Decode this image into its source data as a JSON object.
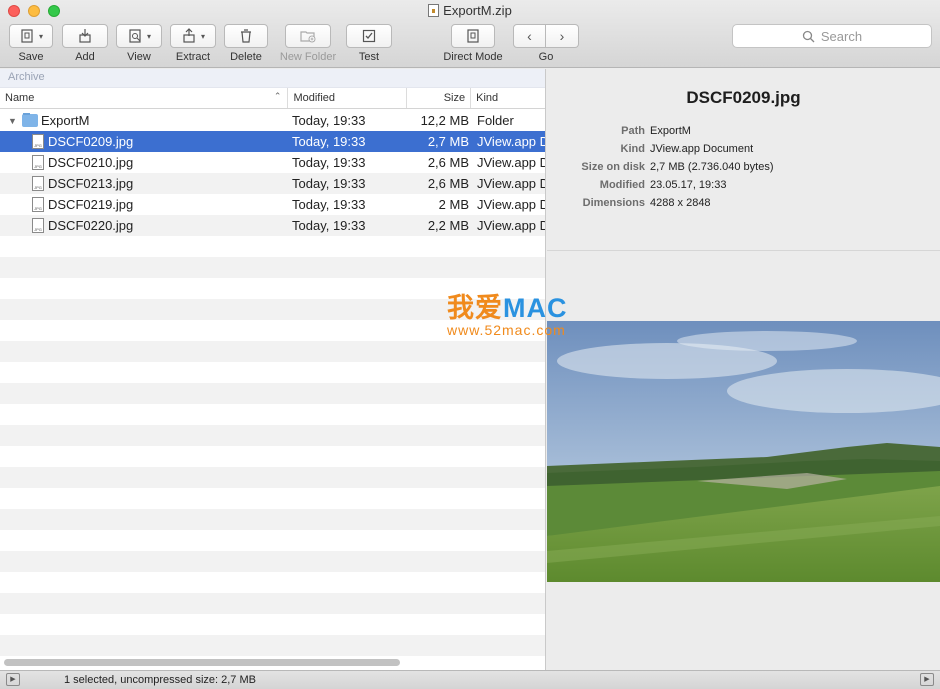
{
  "window": {
    "title": "ExportM.zip"
  },
  "toolbar": {
    "save": "Save",
    "add": "Add",
    "view": "View",
    "extract": "Extract",
    "delete": "Delete",
    "new_folder": "New Folder",
    "test": "Test",
    "direct_mode": "Direct Mode",
    "go": "Go"
  },
  "search": {
    "placeholder": "Search"
  },
  "archive_header": "Archive",
  "columns": {
    "name": "Name",
    "modified": "Modified",
    "size": "Size",
    "kind": "Kind"
  },
  "rows": [
    {
      "name": "ExportM",
      "modified": "Today, 19:33",
      "size": "12,2 MB",
      "kind": "Folder"
    },
    {
      "name": "DSCF0209.jpg",
      "modified": "Today, 19:33",
      "size": "2,7 MB",
      "kind": "JView.app Document"
    },
    {
      "name": "DSCF0210.jpg",
      "modified": "Today, 19:33",
      "size": "2,6 MB",
      "kind": "JView.app Document"
    },
    {
      "name": "DSCF0213.jpg",
      "modified": "Today, 19:33",
      "size": "2,6 MB",
      "kind": "JView.app Document"
    },
    {
      "name": "DSCF0219.jpg",
      "modified": "Today, 19:33",
      "size": "2 MB",
      "kind": "JView.app Document"
    },
    {
      "name": "DSCF0220.jpg",
      "modified": "Today, 19:33",
      "size": "2,2 MB",
      "kind": "JView.app Document"
    }
  ],
  "preview": {
    "title": "DSCF0209.jpg",
    "info": [
      {
        "key": "Path",
        "value": "ExportM"
      },
      {
        "key": "Kind",
        "value": "JView.app Document"
      },
      {
        "key": "Size on disk",
        "value": "2,7 MB (2.736.040 bytes)"
      },
      {
        "key": "Modified",
        "value": "23.05.17, 19:33"
      },
      {
        "key": "Dimensions",
        "value": "4288 x 2848"
      }
    ]
  },
  "watermark": {
    "line1_a": "我爱",
    "line1_b": "MAC",
    "line2": "www.52mac.com"
  },
  "status": "1 selected, uncompressed size: 2,7 MB",
  "colors": {
    "selection": "#3c6fd0",
    "sky": "#7fa0c8",
    "grass": "#6e9a3c"
  }
}
